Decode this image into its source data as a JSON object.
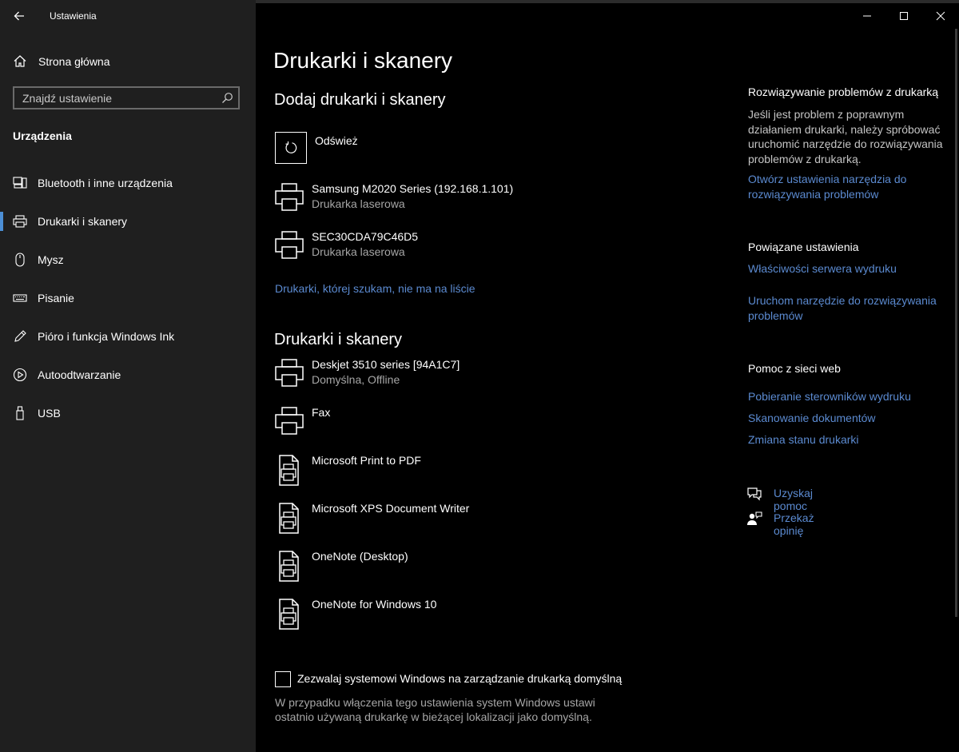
{
  "app": {
    "title": "Ustawienia"
  },
  "sidebar": {
    "home_label": "Strona główna",
    "search_placeholder": "Znajdź ustawienie",
    "section_label": "Urządzenia",
    "items": [
      {
        "label": "Bluetooth i inne urządzenia",
        "icon": "bluetooth-devices-icon",
        "selected": false
      },
      {
        "label": "Drukarki i skanery",
        "icon": "printer-icon",
        "selected": true
      },
      {
        "label": "Mysz",
        "icon": "mouse-icon",
        "selected": false
      },
      {
        "label": "Pisanie",
        "icon": "keyboard-icon",
        "selected": false
      },
      {
        "label": "Pióro i funkcja Windows Ink",
        "icon": "pen-icon",
        "selected": false
      },
      {
        "label": "Autoodtwarzanie",
        "icon": "autoplay-icon",
        "selected": false
      },
      {
        "label": "USB",
        "icon": "usb-icon",
        "selected": false
      }
    ]
  },
  "main": {
    "title": "Drukarki i skanery",
    "add_section": {
      "heading": "Dodaj drukarki i skanery",
      "refresh_label": "Odśwież",
      "found_devices": [
        {
          "name": "Samsung M2020 Series (192.168.1.101)",
          "status": "Drukarka laserowa"
        },
        {
          "name": "SEC30CDA79C46D5",
          "status": "Drukarka laserowa"
        }
      ],
      "not_listed_link": "Drukarki, której szukam, nie ma na liście"
    },
    "installed_section": {
      "heading": "Drukarki i skanery",
      "devices": [
        {
          "name": "Deskjet 3510 series [94A1C7]",
          "status": "Domyślna, Offline",
          "icon": "printer-icon"
        },
        {
          "name": "Fax",
          "status": "",
          "icon": "printer-icon"
        },
        {
          "name": "Microsoft Print to PDF",
          "status": "",
          "icon": "document-printer-icon"
        },
        {
          "name": "Microsoft XPS Document Writer",
          "status": "",
          "icon": "document-printer-icon"
        },
        {
          "name": "OneNote (Desktop)",
          "status": "",
          "icon": "document-printer-icon"
        },
        {
          "name": "OneNote for Windows 10",
          "status": "",
          "icon": "document-printer-icon"
        }
      ]
    },
    "default_printer": {
      "checked": false,
      "label": "Zezwalaj systemowi Windows na zarządzanie drukarką domyślną",
      "description": "W przypadku włączenia tego ustawienia system Windows ustawi ostatnio używaną drukarkę w bieżącej lokalizacji jako domyślną."
    }
  },
  "right_panel": {
    "troubleshoot": {
      "heading": "Rozwiązywanie problemów z drukarką",
      "text": "Jeśli jest problem z poprawnym działaniem drukarki, należy spróbować uruchomić narzędzie do rozwiązywania problemów z drukarką.",
      "link": "Otwórz ustawienia narzędzia do rozwiązywania problemów"
    },
    "related": {
      "heading": "Powiązane ustawienia",
      "links": [
        "Właściwości serwera wydruku",
        "Uruchom narzędzie do rozwiązywania problemów"
      ]
    },
    "web_help": {
      "heading": "Pomoc z sieci web",
      "links": [
        "Pobieranie sterowników wydruku",
        "Skanowanie dokumentów",
        "Zmiana stanu drukarki"
      ]
    },
    "help_links": [
      {
        "label": "Uzyskaj pomoc",
        "icon": "chat-help-icon"
      },
      {
        "label": "Przekaż opinię",
        "icon": "feedback-icon"
      }
    ]
  },
  "colors": {
    "link": "#5b8ad0",
    "accent": "#4c8fd6",
    "sidebar_bg": "#1f1f1f",
    "main_bg": "#000000"
  }
}
